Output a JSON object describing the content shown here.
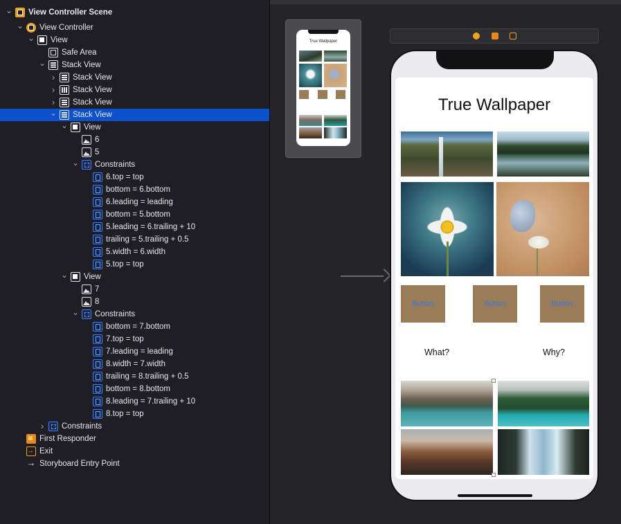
{
  "outline": {
    "rows": [
      {
        "label": "View Controller Scene",
        "icon": "scene-icon",
        "disclosure": "open",
        "bold": true
      },
      {
        "label": "View Controller",
        "icon": "view-controller-icon",
        "disclosure": "open"
      },
      {
        "label": "View",
        "icon": "view-icon",
        "disclosure": "open"
      },
      {
        "label": "Safe Area",
        "icon": "safe-area-icon",
        "disclosure": "none"
      },
      {
        "label": "Stack View",
        "icon": "stack-view-icon",
        "disclosure": "open"
      },
      {
        "label": "Stack View",
        "icon": "stack-view-icon",
        "disclosure": "closed"
      },
      {
        "label": "Stack View",
        "icon": "horizontal-stack-icon",
        "disclosure": "closed"
      },
      {
        "label": "Stack View",
        "icon": "stack-view-icon",
        "disclosure": "closed"
      },
      {
        "label": "Stack View",
        "icon": "stack-view-icon",
        "disclosure": "open",
        "selected": true
      },
      {
        "label": "View",
        "icon": "view-icon",
        "disclosure": "open"
      },
      {
        "label": "6",
        "icon": "image-icon",
        "disclosure": "none"
      },
      {
        "label": "5",
        "icon": "image-icon",
        "disclosure": "none"
      },
      {
        "label": "Constraints",
        "icon": "constraints-icon",
        "disclosure": "open"
      },
      {
        "label": "6.top = top",
        "icon": "constraint-icon",
        "disclosure": "none"
      },
      {
        "label": "bottom = 6.bottom",
        "icon": "constraint-icon",
        "disclosure": "none"
      },
      {
        "label": "6.leading = leading",
        "icon": "constraint-icon",
        "disclosure": "none"
      },
      {
        "label": "bottom = 5.bottom",
        "icon": "constraint-icon",
        "disclosure": "none"
      },
      {
        "label": "5.leading = 6.trailing + 10",
        "icon": "constraint-icon",
        "disclosure": "none"
      },
      {
        "label": "trailing = 5.trailing + 0.5",
        "icon": "constraint-icon",
        "disclosure": "none"
      },
      {
        "label": "5.width = 6.width",
        "icon": "constraint-icon",
        "disclosure": "none"
      },
      {
        "label": "5.top = top",
        "icon": "constraint-icon",
        "disclosure": "none"
      },
      {
        "label": "View",
        "icon": "view-icon",
        "disclosure": "open"
      },
      {
        "label": "7",
        "icon": "image-icon",
        "disclosure": "none"
      },
      {
        "label": "8",
        "icon": "image-icon",
        "disclosure": "none"
      },
      {
        "label": "Constraints",
        "icon": "constraints-icon",
        "disclosure": "open"
      },
      {
        "label": "bottom = 7.bottom",
        "icon": "constraint-icon",
        "disclosure": "none"
      },
      {
        "label": "7.top = top",
        "icon": "constraint-icon",
        "disclosure": "none"
      },
      {
        "label": "7.leading = leading",
        "icon": "constraint-icon",
        "disclosure": "none"
      },
      {
        "label": "8.width = 7.width",
        "icon": "constraint-icon",
        "disclosure": "none"
      },
      {
        "label": "trailing = 8.trailing + 0.5",
        "icon": "constraint-icon",
        "disclosure": "none"
      },
      {
        "label": "bottom = 8.bottom",
        "icon": "constraint-icon",
        "disclosure": "none"
      },
      {
        "label": "8.leading = 7.trailing + 10",
        "icon": "constraint-icon",
        "disclosure": "none"
      },
      {
        "label": "8.top = top",
        "icon": "constraint-icon",
        "disclosure": "none"
      },
      {
        "label": "Constraints",
        "icon": "constraints-icon",
        "disclosure": "closed"
      },
      {
        "label": "First Responder",
        "icon": "first-responder-icon",
        "disclosure": "none"
      },
      {
        "label": "Exit",
        "icon": "exit-icon",
        "disclosure": "none"
      },
      {
        "label": "Storyboard Entry Point",
        "icon": "entry-point-arrow-icon",
        "disclosure": "none"
      }
    ]
  },
  "canvas": {
    "app_title": "True Wallpaper",
    "preview_title": "True Wallpaper",
    "buttons": [
      "Button",
      "Button",
      "Button"
    ],
    "labels": [
      "What?",
      "Why?"
    ]
  },
  "colors": {
    "selection": "#0b50cc",
    "accent": "#f0a020",
    "constraint_blue": "#3a7bff",
    "button_fill": "#9a7c58",
    "button_text": "#3a78e0"
  }
}
